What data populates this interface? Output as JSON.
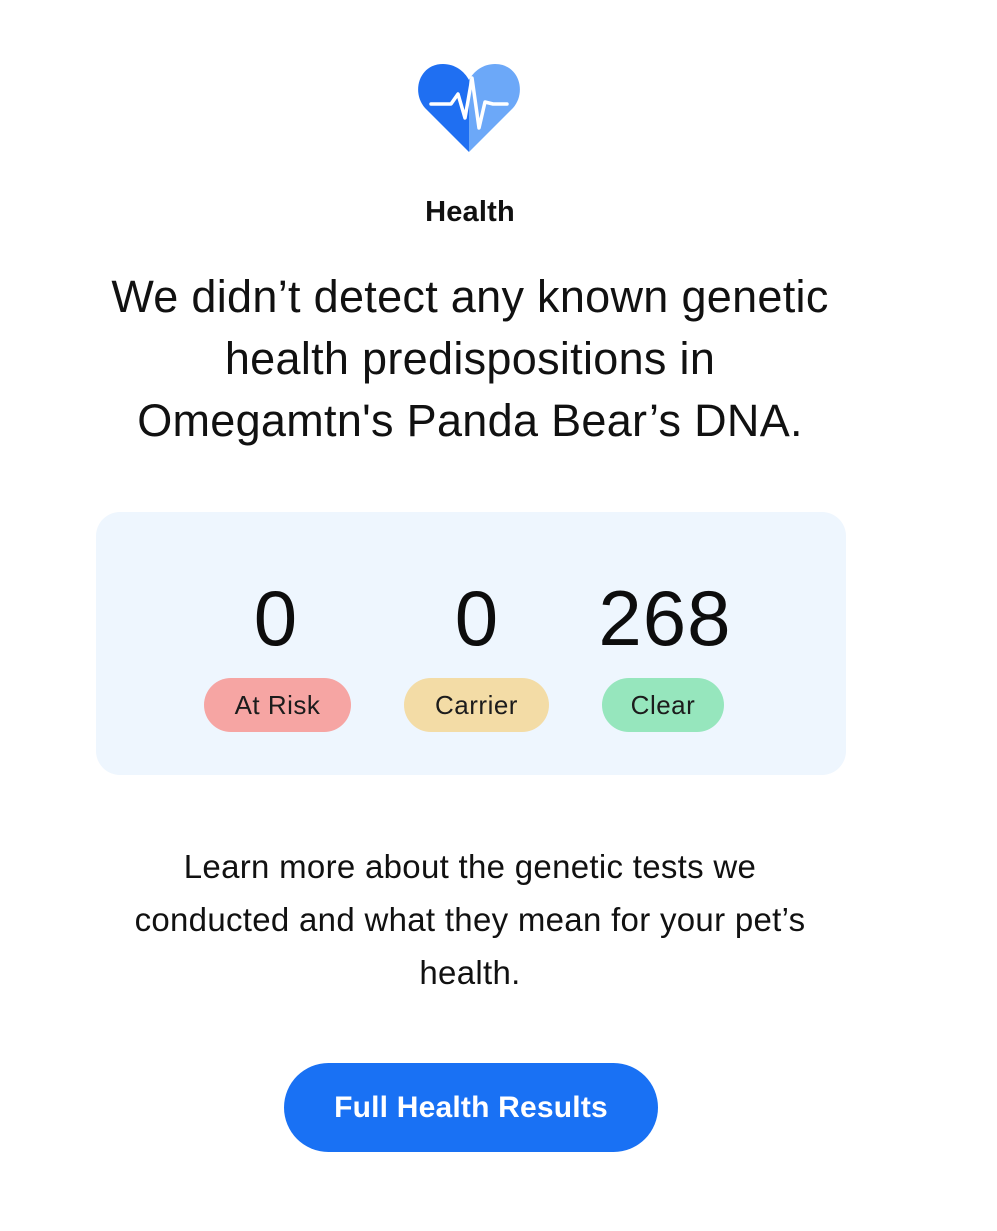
{
  "header": {
    "icon": "heart-pulse-icon",
    "title": "Health"
  },
  "headline": "We didn’t detect any known genetic health predispositions in Omegamtn's Panda Bear’s DNA.",
  "summary": {
    "stats": [
      {
        "value": "0",
        "label": "At Risk",
        "color": "#f6a5a3"
      },
      {
        "value": "0",
        "label": "Carrier",
        "color": "#f3dca6"
      },
      {
        "value": "268",
        "label": "Clear",
        "color": "#96e6bd"
      }
    ]
  },
  "description": "Learn more about the genetic tests we conducted and what they mean for your pet’s health.",
  "cta": {
    "label": "Full Health Results",
    "color": "#1971f4"
  },
  "colors": {
    "heart_dark": "#1f6ff2",
    "heart_light": "#6ca8f8",
    "card_background": "#eef6fe"
  }
}
